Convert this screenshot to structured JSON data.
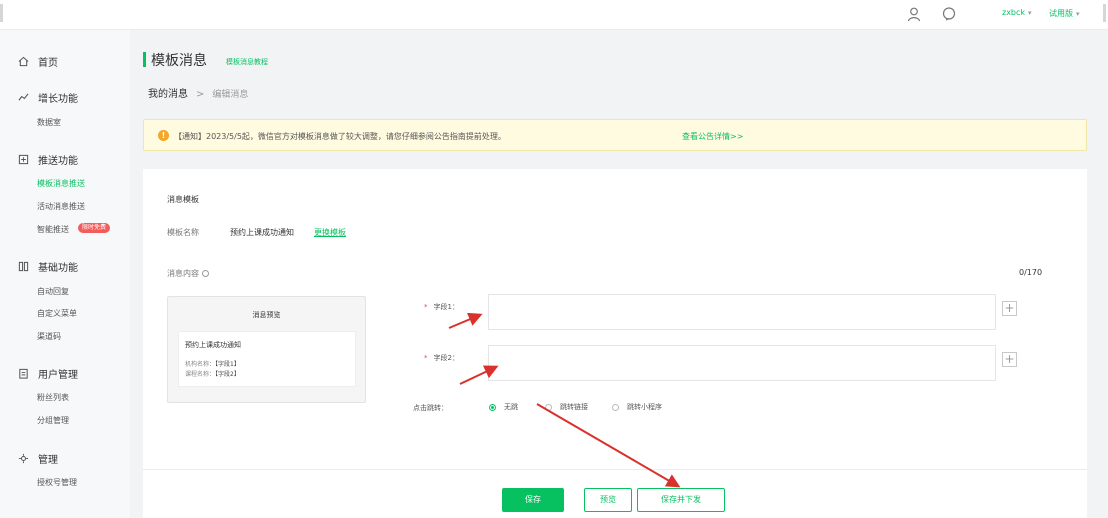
{
  "topbar": {
    "account_name": "zxbck",
    "account_caret": "▾",
    "trial_label": "试用版",
    "trial_caret": "▾"
  },
  "sidebar": {
    "home": "首页",
    "groups": [
      {
        "label": "增长功能",
        "items": [
          {
            "label": "数据室"
          }
        ]
      },
      {
        "label": "推送功能",
        "items": [
          {
            "label": "模板消息推送",
            "active": true
          },
          {
            "label": "活动消息推送"
          },
          {
            "label": "智能推送",
            "badge": "限时免费"
          }
        ]
      },
      {
        "label": "基础功能",
        "items": [
          {
            "label": "自动回复"
          },
          {
            "label": "自定义菜单"
          },
          {
            "label": "渠道码"
          }
        ]
      },
      {
        "label": "用户管理",
        "items": [
          {
            "label": "粉丝列表"
          },
          {
            "label": "分组管理"
          }
        ]
      },
      {
        "label": "管理",
        "items": [
          {
            "label": "授权号管理"
          }
        ]
      }
    ]
  },
  "header": {
    "title": "模板消息",
    "title_link": "模板消息教程"
  },
  "breadcrumb": {
    "parent": "我的消息",
    "separator": ">",
    "current": "编辑消息"
  },
  "notice": {
    "text": "【通知】2023/5/5起，微信官方对模板消息做了较大调整，请您仔细参阅公告指南提前处理。",
    "link": "查看公告详情>>"
  },
  "form": {
    "section_title": "消息模板",
    "template_name_label": "模板名称",
    "template_name_value": "预约上课成功通知",
    "change_template": "更换模板",
    "content_label": "消息内容",
    "counter": "0/170",
    "field1_label": "字段1",
    "field2_label": "字段2",
    "field1_value": "",
    "field2_value": "",
    "required_mark": "*",
    "colon": "：",
    "plus": "+",
    "click_action_label": "点击跳转",
    "radio_options": [
      {
        "label": "无跳",
        "selected": true
      },
      {
        "label": "跳转链接",
        "selected": false
      },
      {
        "label": "跳转小程序",
        "selected": false
      }
    ]
  },
  "preview": {
    "title": "消息预览",
    "line1": "预约上课成功通知",
    "line2_key": "机构名称：",
    "line2_val": "【字段1】",
    "line3_key": "课程名称：",
    "line3_val": "【字段2】"
  },
  "footer": {
    "save": "保存",
    "preview": "预览",
    "save_and_next": "保存并下发"
  },
  "colors": {
    "accent": "#07c160",
    "arrow": "#d9312b",
    "notice_bg": "#fffbe0",
    "badge": "#f45b5b"
  },
  "icons": {
    "user": "user-icon",
    "chat": "chat-icon",
    "home": "home-icon",
    "growth": "growth-icon",
    "push": "push-icon",
    "basic": "grid-icon",
    "users": "clipboard-icon",
    "admin": "gear-icon"
  }
}
